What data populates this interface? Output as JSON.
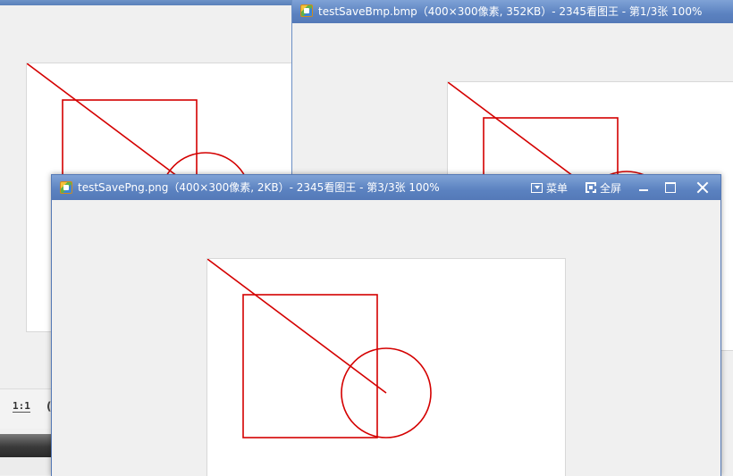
{
  "windows": {
    "back": {
      "statusbar": {
        "zoom_1to1": "1:1",
        "fit_label": "("
      }
    },
    "middle": {
      "title": "testSaveBmp.bmp（400×300像素, 352KB）- 2345看图王 - 第1/3张 100%"
    },
    "front": {
      "title": "testSavePng.png（400×300像素, 2KB）- 2345看图王 - 第3/3张 100%",
      "menu_label": "菜单",
      "fullscreen_label": "全屏"
    }
  },
  "icons": {
    "app": "2345-viewer-app-icon",
    "menu": "menu-dropdown-icon",
    "fullscreen": "fullscreen-icon",
    "minimize": "minimize-icon",
    "maximize": "maximize-icon",
    "close": "close-icon"
  },
  "colors": {
    "titlebar": "#5b82c0",
    "drawing_stroke": "#d40000",
    "canvas": "#ffffff",
    "window_bg": "#f0f0f0"
  }
}
